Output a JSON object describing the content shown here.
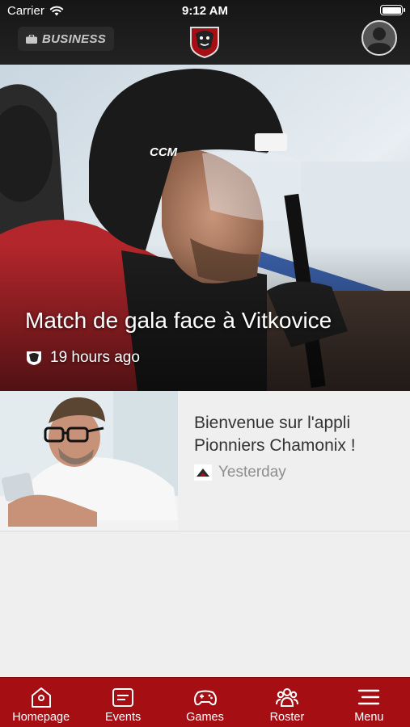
{
  "status_bar": {
    "carrier": "Carrier",
    "time": "9:12 AM"
  },
  "header": {
    "business_label": "BUSINESS"
  },
  "hero": {
    "title": "Match de gala face à Vitkovice",
    "time": "19 hours ago"
  },
  "articles": [
    {
      "title": "Bienvenue sur l'appli Pionniers Chamonix !",
      "time": "Yesterday"
    }
  ],
  "tabs": [
    {
      "label": "Homepage",
      "icon": "home-icon"
    },
    {
      "label": "Events",
      "icon": "events-icon"
    },
    {
      "label": "Games",
      "icon": "gamepad-icon"
    },
    {
      "label": "Roster",
      "icon": "roster-icon"
    },
    {
      "label": "Menu",
      "icon": "menu-icon"
    }
  ],
  "colors": {
    "tabbar": "#a50f14",
    "header": "#1b1b1b"
  }
}
